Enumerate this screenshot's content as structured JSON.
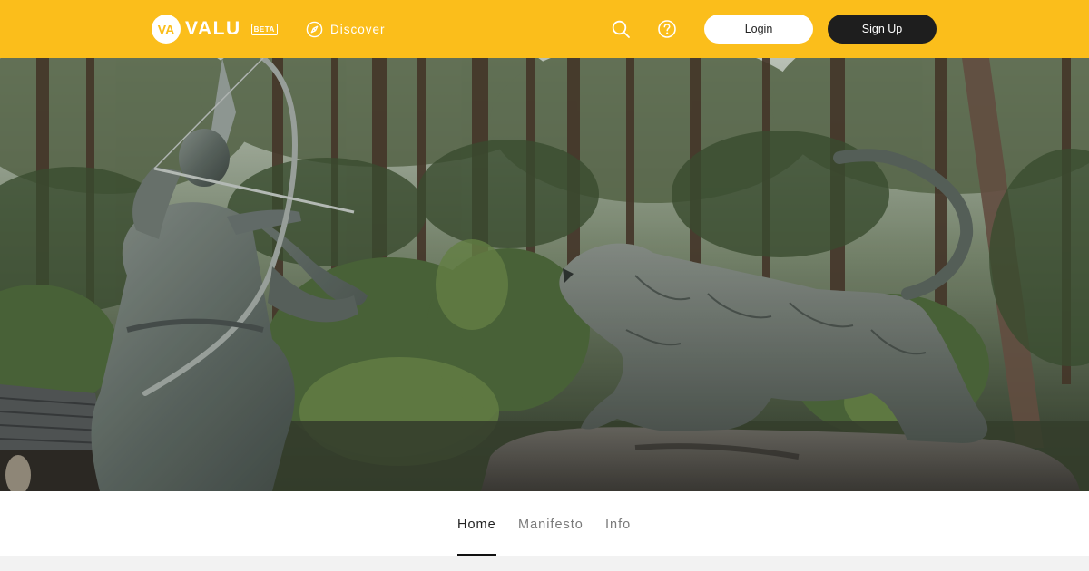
{
  "brand": {
    "name": "VALU",
    "mark": "VA",
    "badge": "BETA",
    "accent_color": "#fbbe1b"
  },
  "nav": {
    "discover_label": "Discover",
    "discover_icon": "compass-icon",
    "search_icon": "search-icon",
    "help_icon": "question-circle-icon"
  },
  "auth": {
    "login_label": "Login",
    "signup_label": "Sign Up"
  },
  "tabs": [
    {
      "label": "Home",
      "active": true
    },
    {
      "label": "Manifesto",
      "active": false
    },
    {
      "label": "Info",
      "active": false
    }
  ]
}
